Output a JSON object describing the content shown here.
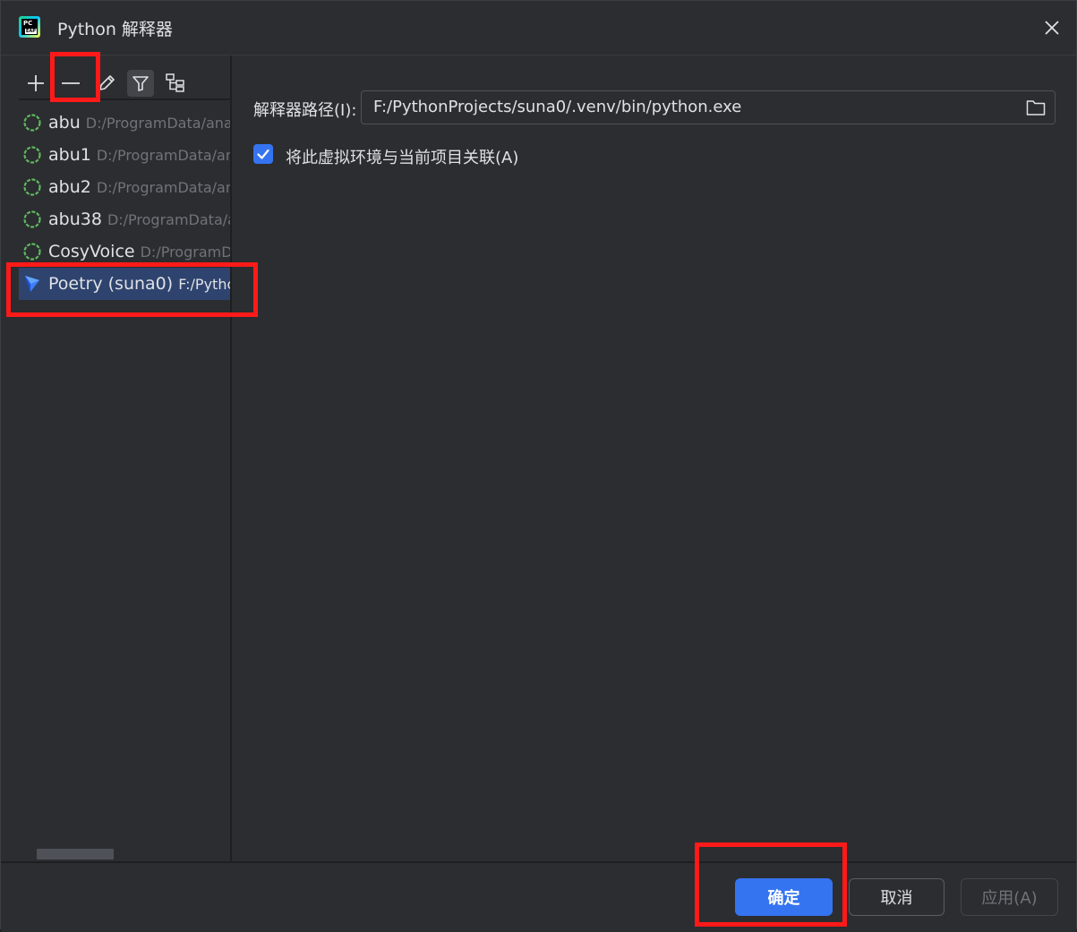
{
  "window": {
    "title": "Python 解释器",
    "logo_text_top": "PC",
    "logo_text_bottom": "EAP"
  },
  "toolbar": {
    "buttons": [
      "add",
      "remove",
      "edit",
      "filter",
      "tree-view"
    ],
    "add_symbol": "+",
    "remove_symbol": "—"
  },
  "interpreters": [
    {
      "name": "abu",
      "path": "D:/ProgramData/anac",
      "icon": "conda-loading-icon"
    },
    {
      "name": "abu1",
      "path": "D:/ProgramData/ana",
      "icon": "conda-loading-icon"
    },
    {
      "name": "abu2",
      "path": "D:/ProgramData/ana",
      "icon": "conda-loading-icon"
    },
    {
      "name": "abu38",
      "path": "D:/ProgramData/ar",
      "icon": "conda-loading-icon"
    },
    {
      "name": "CosyVoice",
      "path": "D:/ProgramDa",
      "icon": "conda-loading-icon"
    },
    {
      "name": "Poetry (suna0)",
      "path": "F:/Python",
      "icon": "poetry-icon",
      "selected": true
    }
  ],
  "details": {
    "path_label": "解释器路径(I):",
    "path_value": "F:/PythonProjects/suna0/.venv/bin/python.exe",
    "associate_checked": true,
    "associate_label": "将此虚拟环境与当前项目关联(A)"
  },
  "footer": {
    "ok_label": "确定",
    "cancel_label": "取消",
    "apply_label": "应用(A)"
  },
  "colors": {
    "accent": "#3574f0",
    "selection": "#2e436e",
    "highlight": "#ff1a1a",
    "conda_green": "#5fb85f"
  }
}
